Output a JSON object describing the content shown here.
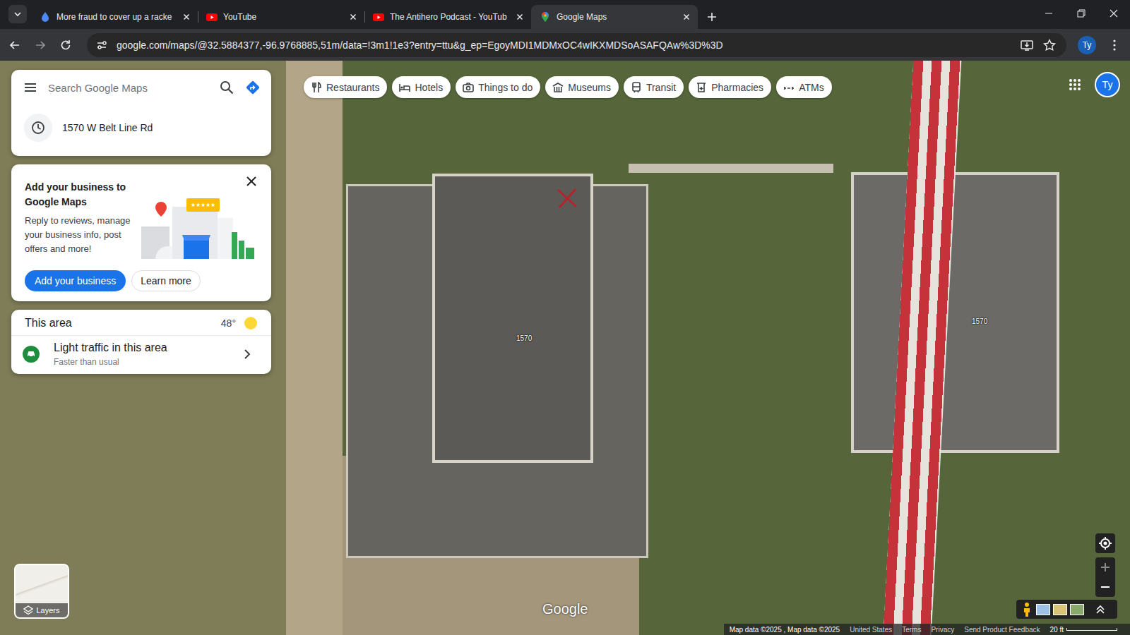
{
  "browser": {
    "tabs": [
      {
        "title": "More fraud to cover up a racke",
        "kind": "drive",
        "selected": false
      },
      {
        "title": "YouTube",
        "kind": "youtube",
        "selected": false
      },
      {
        "title": "The Antihero Podcast - YouTub",
        "kind": "youtube",
        "selected": false
      },
      {
        "title": "Google Maps",
        "kind": "maps",
        "selected": true
      }
    ],
    "url": "google.com/maps/@32.5884377,-96.9768885,51m/data=!3m1!1e3?entry=ttu&g_ep=EgoyMDI1MDMxOC4wIKXMDSoASAFQAw%3D%3D",
    "profile": "Ty",
    "bookmarked": false
  },
  "maps": {
    "search": {
      "placeholder": "Search Google Maps"
    },
    "recent": [
      {
        "label": "1570 W Belt Line Rd"
      }
    ],
    "promo": {
      "title": "Add your business to Google Maps",
      "body": "Reply to reviews, manage your business info, post offers and more!",
      "badge": "★★★★★",
      "primary": "Add your business",
      "secondary": "Learn more"
    },
    "area": {
      "title": "This area",
      "temperature": "48°",
      "traffic": "Light traffic in this area",
      "traffic_detail": "Faster than usual"
    },
    "chips": [
      {
        "label": "Restaurants",
        "kind": "restaurants"
      },
      {
        "label": "Hotels",
        "kind": "hotels"
      },
      {
        "label": "Things to do",
        "kind": "things"
      },
      {
        "label": "Museums",
        "kind": "museums"
      },
      {
        "label": "Transit",
        "kind": "transit"
      },
      {
        "label": "Pharmacies",
        "kind": "pharmacies"
      },
      {
        "label": "ATMs",
        "kind": "atms"
      }
    ],
    "account": "Ty",
    "labels": [
      {
        "text": "1570"
      },
      {
        "text": "1570"
      }
    ],
    "layers": "Layers",
    "logo": "Google",
    "footer": [
      "Map data ©2025 , Map data ©2025",
      "United States",
      "Terms",
      "Privacy",
      "Send Product Feedback"
    ],
    "scale": "20 ft"
  }
}
